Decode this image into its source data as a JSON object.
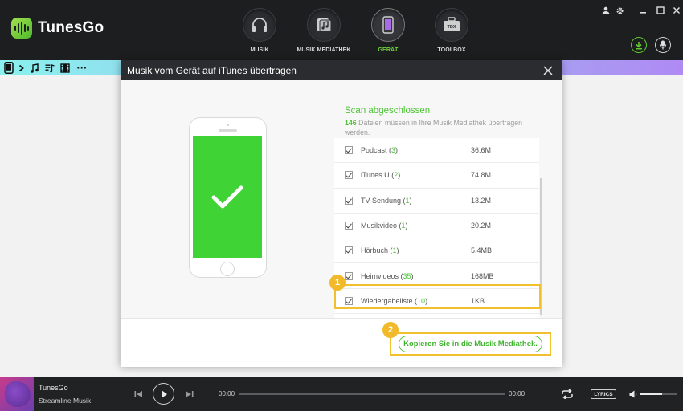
{
  "app": {
    "name": "TunesGo"
  },
  "nav": {
    "tabs": [
      {
        "label": "MUSIK",
        "icon": "headphones-icon",
        "active": false
      },
      {
        "label": "MUSIK MEDIATHEK",
        "icon": "music-library-icon",
        "active": false
      },
      {
        "label": "GERÄT",
        "icon": "phone-device-icon",
        "active": true
      },
      {
        "label": "TOOLBOX",
        "icon": "toolbox-icon",
        "active": false
      }
    ],
    "toolbox_badge": "TBX"
  },
  "window_controls": [
    "user-icon",
    "gear-icon",
    "minimize-icon",
    "maximize-icon",
    "close-icon"
  ],
  "header_actions": [
    "download-icon",
    "microphone-icon"
  ],
  "device_toolbar": {
    "icons": [
      "phone-icon",
      "chevron-right-icon",
      "music-note-icon",
      "playlist-icon",
      "film-icon",
      "more-dots-icon"
    ],
    "more_label": "···"
  },
  "modal": {
    "title": "Musik vom Gerät auf iTunes übertragen",
    "scan_title": "Scan abgeschlossen",
    "scan_count": "146",
    "scan_desc": "Dateien müssen in Ihre Musik Mediathek übertragen werden.",
    "items": [
      {
        "name": "Podcast",
        "count": "3",
        "size": "36.6M",
        "checked": true
      },
      {
        "name": "iTunes U",
        "count": "2",
        "size": "74.8M",
        "checked": true
      },
      {
        "name": "TV-Sendung",
        "count": "1",
        "size": "13.2M",
        "checked": true
      },
      {
        "name": "Musikvideo",
        "count": "1",
        "size": "20.2M",
        "checked": true
      },
      {
        "name": "Hörbuch",
        "count": "1",
        "size": "5.4MB",
        "checked": true
      },
      {
        "name": "Heimvideos",
        "count": "35",
        "size": "168MB",
        "checked": true
      },
      {
        "name": "Wiedergabeliste",
        "count": "10",
        "size": "1KB",
        "checked": true
      }
    ],
    "callout_1": "1",
    "callout_2": "2",
    "copy_button": "Kopieren Sie in die Musik Mediathek."
  },
  "player": {
    "title": "TunesGo",
    "artist": "Streamline Musik",
    "time_current": "00:00",
    "time_total": "00:00",
    "progress": 0,
    "lyrics_label": "LYRICS",
    "volume": 0.6
  },
  "colors": {
    "accent": "#4cc534",
    "callout": "#f2c02c",
    "dark": "#1d1e20"
  }
}
